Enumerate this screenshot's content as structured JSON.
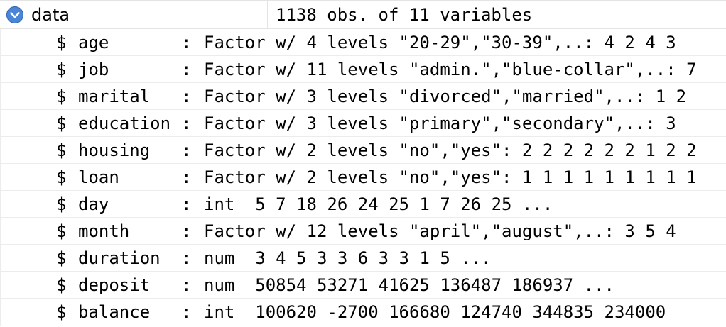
{
  "object": {
    "name": "data",
    "summary": "1138 obs. of 11 variables",
    "expand_icon": "chevron-down-circle-icon",
    "accent_color": "#4a86d8"
  },
  "variables": [
    {
      "name": "age",
      "info": "Factor w/ 4 levels \"20-29\",\"30-39\",..: 4 2 4 3"
    },
    {
      "name": "job",
      "info": "Factor w/ 11 levels \"admin.\",\"blue-collar\",..: 7"
    },
    {
      "name": "marital",
      "info": "Factor w/ 3 levels \"divorced\",\"married\",..: 1 2"
    },
    {
      "name": "education",
      "info": "Factor w/ 3 levels \"primary\",\"secondary\",..: 3"
    },
    {
      "name": "housing",
      "info": "Factor w/ 2 levels \"no\",\"yes\": 2 2 2 2 2 2 1 2 2"
    },
    {
      "name": "loan",
      "info": "Factor w/ 2 levels \"no\",\"yes\": 1 1 1 1 1 1 1 1 1"
    },
    {
      "name": "day",
      "info": "int  5 7 18 26 24 25 1 7 26 25 ..."
    },
    {
      "name": "month",
      "info": "Factor w/ 12 levels \"april\",\"august\",..: 3 5 4"
    },
    {
      "name": "duration",
      "info": "num  3 4 5 3 3 6 3 3 1 5 ..."
    },
    {
      "name": "deposit",
      "info": "num  50854 53271 41625 136487 186937 ..."
    },
    {
      "name": "balance",
      "info": "int  100620 -2700 166680 124740 344835 234000"
    }
  ],
  "symbols": {
    "dollar": "$",
    "colon": ":"
  }
}
